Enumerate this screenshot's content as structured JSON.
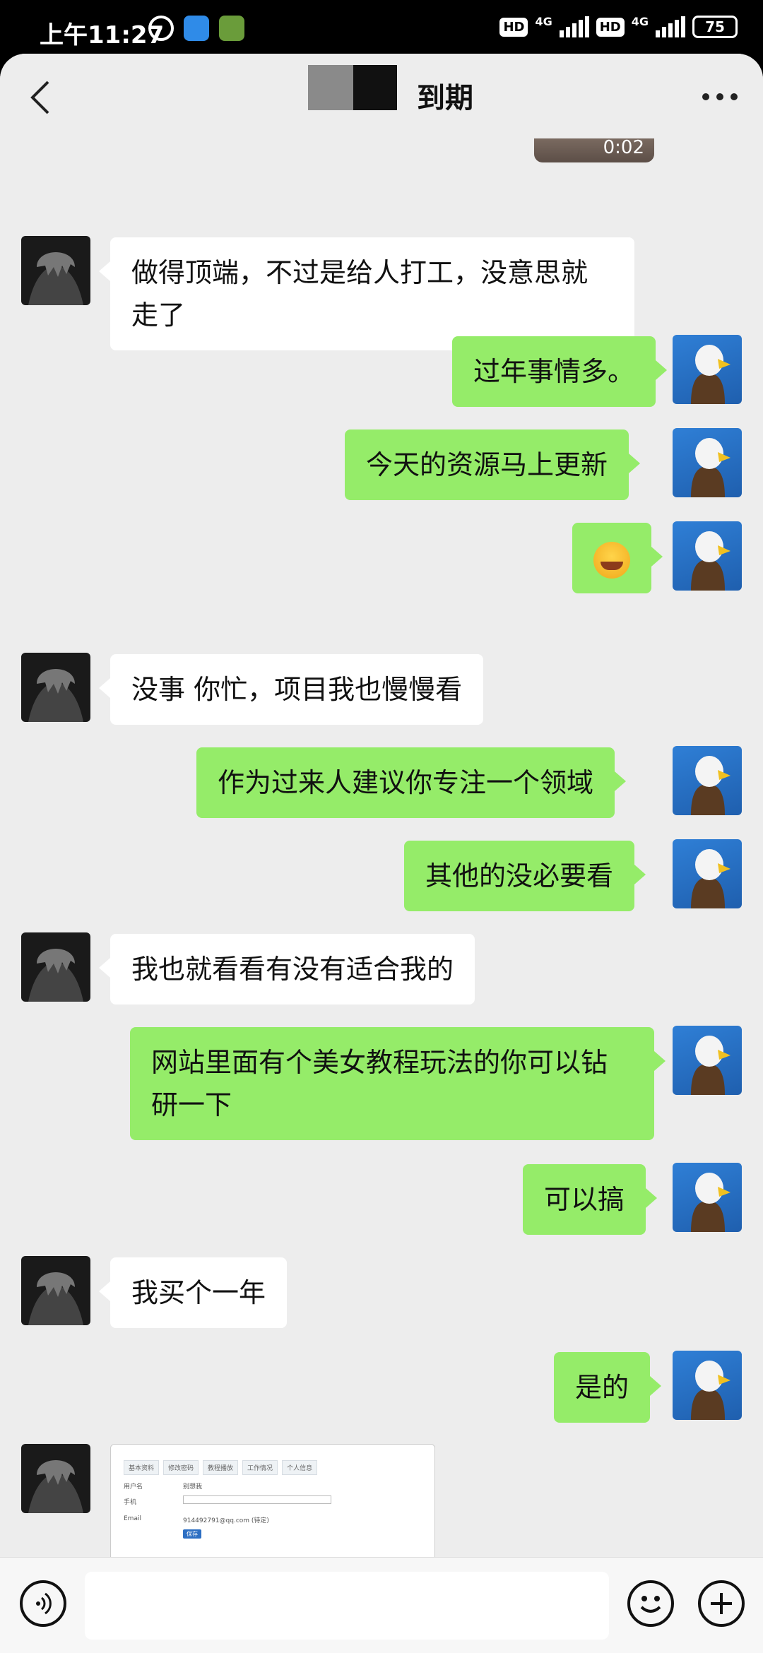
{
  "status_bar": {
    "time": "上午11:27",
    "hd1": "HD",
    "net1": "4G",
    "hd2": "HD",
    "net2": "4G",
    "battery": "75"
  },
  "header": {
    "title": "到期"
  },
  "video": {
    "duration": "0:02"
  },
  "messages": [
    {
      "side": "left",
      "text": "做得顶端，不过是给人打工，没意思就走了"
    },
    {
      "side": "right",
      "text": "过年事情多。"
    },
    {
      "side": "right",
      "text": "今天的资源马上更新"
    },
    {
      "side": "right",
      "type": "emoji",
      "emoji": "laugh-cry-emoji"
    },
    {
      "side": "left",
      "text": "没事 你忙，项目我也慢慢看"
    },
    {
      "side": "right",
      "text": "作为过来人建议你专注一个领域"
    },
    {
      "side": "right",
      "text": "其他的没必要看"
    },
    {
      "side": "left",
      "text": "我也就看看有没有适合我的"
    },
    {
      "side": "right",
      "text": "网站里面有个美女教程玩法的你可以钻研一下"
    },
    {
      "side": "right",
      "text": "可以搞"
    },
    {
      "side": "left",
      "text": "我买个一年"
    },
    {
      "side": "right",
      "text": "是的"
    },
    {
      "side": "left",
      "type": "image"
    }
  ],
  "screenshot_card": {
    "tabs": [
      "基本资料",
      "修改密码",
      "教程播放",
      "工作情况",
      "个人信息"
    ],
    "rows": [
      {
        "label": "用户名",
        "value": "别想我"
      },
      {
        "label": "手机",
        "value": ""
      },
      {
        "label": "Email",
        "value": "914492791@qq.com (待定)"
      }
    ],
    "button": "保存"
  },
  "colors": {
    "sent_bubble": "#95ec69",
    "received_bubble": "#ffffff",
    "background": "#ededed"
  }
}
